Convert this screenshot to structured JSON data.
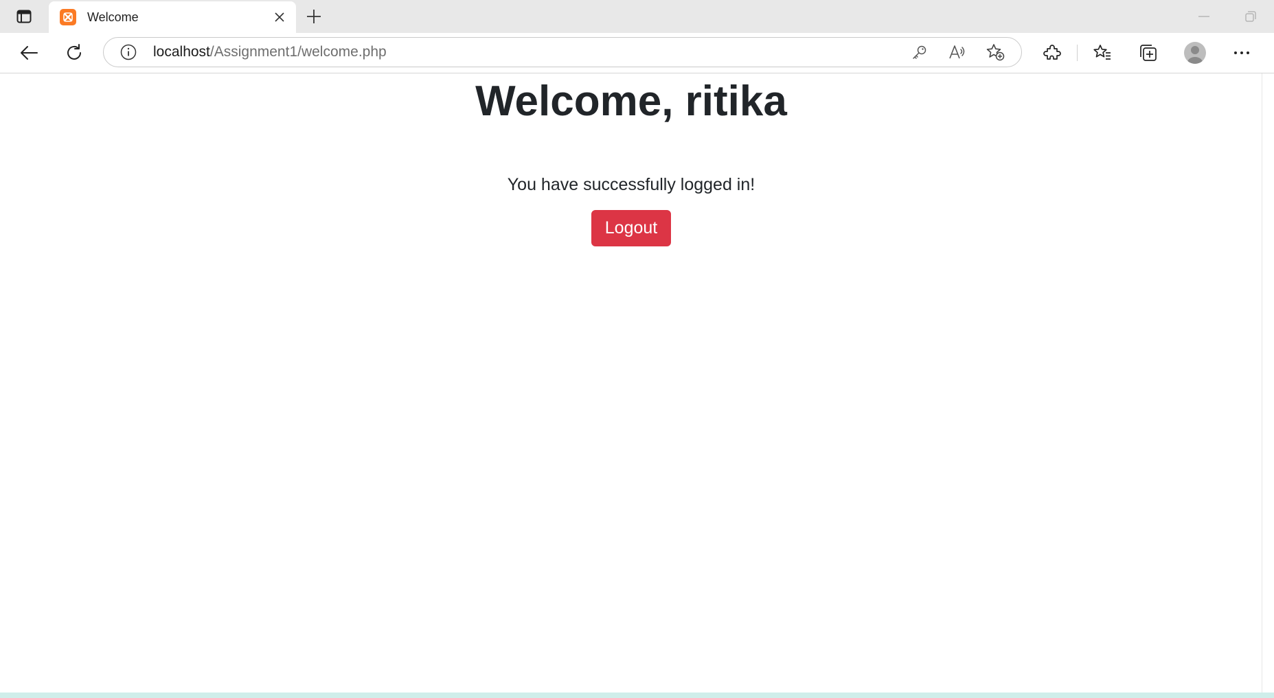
{
  "browser": {
    "tab": {
      "title": "Welcome",
      "favicon": "xampp-icon"
    },
    "address_bar": {
      "host": "localhost",
      "path": "/Assignment1/welcome.php"
    },
    "icons": {
      "tab_actions": "tab-actions-icon",
      "close_tab": "close-icon",
      "new_tab": "plus-icon",
      "back": "arrow-left-icon",
      "refresh": "refresh-icon",
      "site_info": "info-icon",
      "password": "key-icon",
      "read_aloud": "read-aloud-icon",
      "add_favorite": "star-add-icon",
      "extensions": "puzzle-icon",
      "favorites": "favorites-icon",
      "collections": "collections-icon",
      "profile": "avatar",
      "more": "more-icon",
      "minimize": "minimize-icon",
      "restore": "restore-icon"
    }
  },
  "page": {
    "heading": "Welcome, ritika",
    "message": "You have successfully logged in!",
    "logout_label": "Logout"
  },
  "colors": {
    "logout_button": "#dc3545",
    "text": "#212529",
    "favicon": "#fb7a24"
  }
}
